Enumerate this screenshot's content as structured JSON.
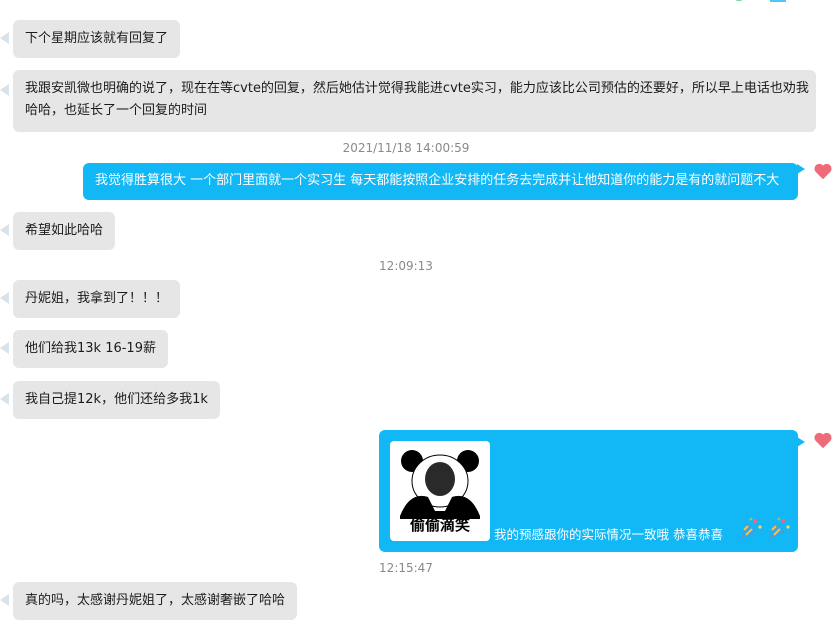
{
  "colors": {
    "incoming_bubble": "#e6e6e6",
    "outgoing_bubble": "#12b7f5",
    "timestamp_text": "#8a8a8a",
    "heart": "#ef6b7a"
  },
  "messages": [
    {
      "text": "下个星期应该就有回复了"
    },
    {
      "line1": "我跟安凯微也明确的说了，现在在等cvte的回复，然后她估计觉得我能进cvte实习，能力应该比公司预估的还要好，所以早上电话也劝我",
      "line2": "哈哈，也延长了一个回复的时间"
    },
    {
      "text": "我觉得胜算很大  一个部门里面就一个实习生  每天都能按照企业安排的任务去完成并让他知道你的能力是有的就问题不大"
    },
    {
      "text": "希望如此哈哈"
    },
    {
      "text": "丹妮姐，我拿到了！！！"
    },
    {
      "text": "他们给我13k 16-19薪"
    },
    {
      "text": "我自己提12k，他们还给多我1k"
    },
    {
      "sticker_caption": "偷偷滴笑",
      "text": "我的预感跟你的实际情况一致哦  恭喜恭喜",
      "sticker_icon": "panda-meme-sticker",
      "emoji_icon": "party-popper-icon"
    },
    {
      "text": "真的吗，太感谢丹妮姐了，太感谢奢嵌了哈哈"
    }
  ],
  "timestamps": [
    "2021/11/18 14:00:59",
    "12:09:13",
    "12:15:47"
  ],
  "icons": [
    "heart-reaction-icon",
    "party-popper-icon"
  ]
}
